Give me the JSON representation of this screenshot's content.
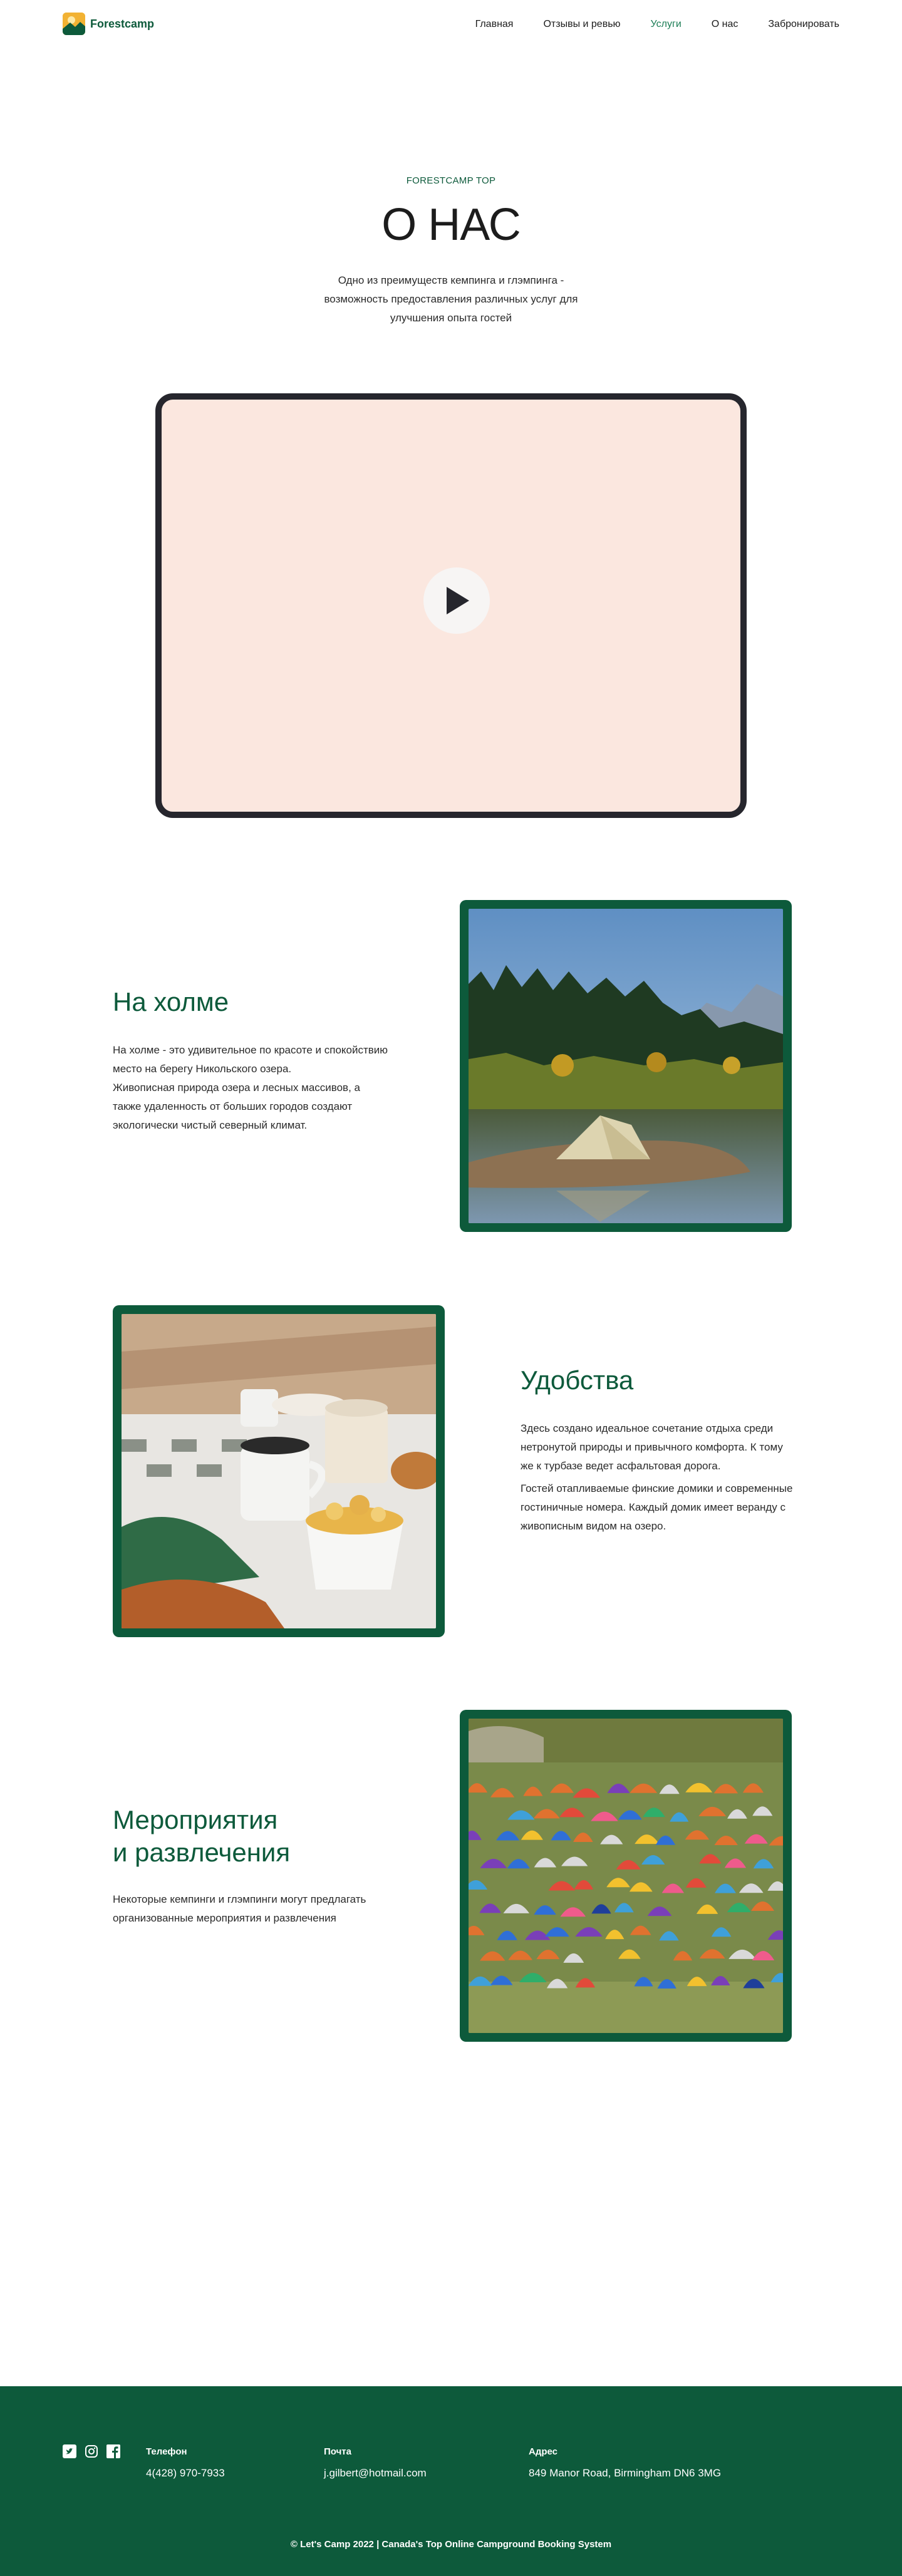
{
  "header": {
    "logo_text": "Forestcamp",
    "nav": [
      {
        "label": "Главная",
        "active": false
      },
      {
        "label": "Отзывы и ревью",
        "active": false
      },
      {
        "label": "Услуги",
        "active": true
      },
      {
        "label": "О нас",
        "active": false
      },
      {
        "label": "Забронировать",
        "active": false
      }
    ]
  },
  "hero": {
    "eyebrow": "FORESTCAMP TOP",
    "title": "О НАС",
    "description": "Одно из преимуществ кемпинга и глэмпинга - возможность предоставления различных услуг для улучшения опыта гостей"
  },
  "video": {
    "play_icon": "play-icon",
    "background": "#fbe7df"
  },
  "sections": [
    {
      "title": "На холме",
      "paragraphs": [
        "На холме - это удивительное по красоте и спокойствию место на берегу Никольского озера.",
        "Живописная природа озера и лесных массивов, а также удаленность от больших городов создают экологически чистый северный климат."
      ]
    },
    {
      "title": "Удобства",
      "paragraphs": [
        "Здесь создано идеальное сочетание отдыха среди нетронутой природы и привычного комфорта. К тому же к турбазе ведет асфальтовая дорога.",
        "Гостей отапливаемые финские домики и современные гостиничные номера. Каждый домик имеет веранду с живописным видом на озеро."
      ]
    },
    {
      "title_line1": "Мероприятия",
      "title_line2": "и развлечения",
      "paragraphs": [
        "Некоторые кемпинги и глэмпинги могут предлагать организованные мероприятия и развлечения"
      ]
    }
  ],
  "footer": {
    "social_icons": [
      "twitter-icon",
      "instagram-icon",
      "facebook-icon"
    ],
    "phone_label": "Телефон",
    "phone": "4(428) 970-7933",
    "email_label": "Почта",
    "email": "j.gilbert@hotmail.com",
    "address_label": "Адрес",
    "address": "849 Manor Road, Birmingham DN6 3MG",
    "copyright": "© Let's Camp 2022 | Canada's Top Online Campground Booking System"
  },
  "colors": {
    "brand": "#0d5a3b",
    "active_nav": "#1b7d55",
    "video_bg": "#fbe7df",
    "frame": "#26262d"
  }
}
